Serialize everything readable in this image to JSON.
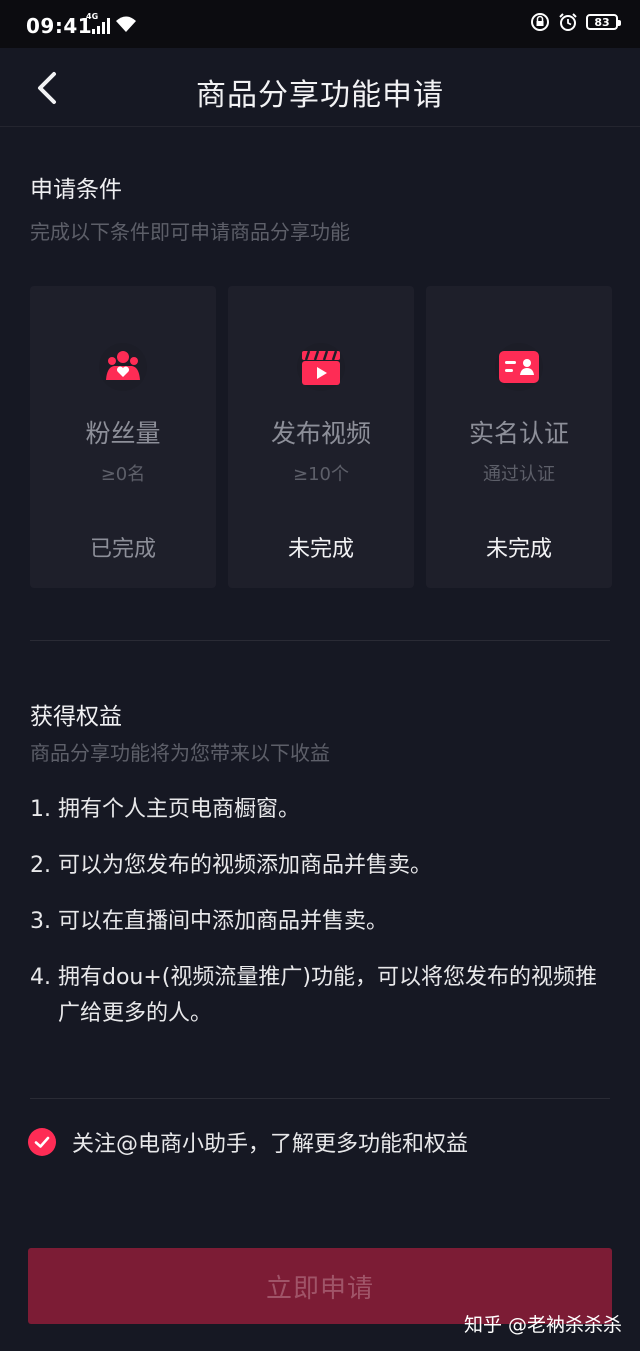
{
  "status_bar": {
    "time": "09:41",
    "network": "4G",
    "battery": "83"
  },
  "header": {
    "title": "商品分享功能申请"
  },
  "conditions": {
    "title": "申请条件",
    "subtitle": "完成以下条件即可申请商品分享功能",
    "cards": [
      {
        "name": "粉丝量",
        "requirement": "≥0名",
        "status": "已完成",
        "icon": "fans-icon"
      },
      {
        "name": "发布视频",
        "requirement": "≥10个",
        "status": "未完成",
        "icon": "video-icon"
      },
      {
        "name": "实名认证",
        "requirement": "通过认证",
        "status": "未完成",
        "icon": "id-card-icon"
      }
    ]
  },
  "benefits": {
    "title": "获得权益",
    "subtitle": "商品分享功能将为您带来以下收益",
    "items": [
      {
        "num": "1.",
        "text": "拥有个人主页电商橱窗。"
      },
      {
        "num": "2.",
        "text": "可以为您发布的视频添加商品并售卖。"
      },
      {
        "num": "3.",
        "text": "可以在直播间中添加商品并售卖。"
      },
      {
        "num": "4.",
        "text": "拥有dou+(视频流量推广)功能，可以将您发布的视频推广给更多的人。"
      }
    ]
  },
  "follow": {
    "checked": true,
    "text": "关注@电商小助手，了解更多功能和权益"
  },
  "apply_button": "立即申请",
  "watermark": "知乎 @老衲杀杀杀",
  "colors": {
    "background": "#161823",
    "accent": "#fe2c55",
    "button_disabled": "#7c1c35"
  }
}
